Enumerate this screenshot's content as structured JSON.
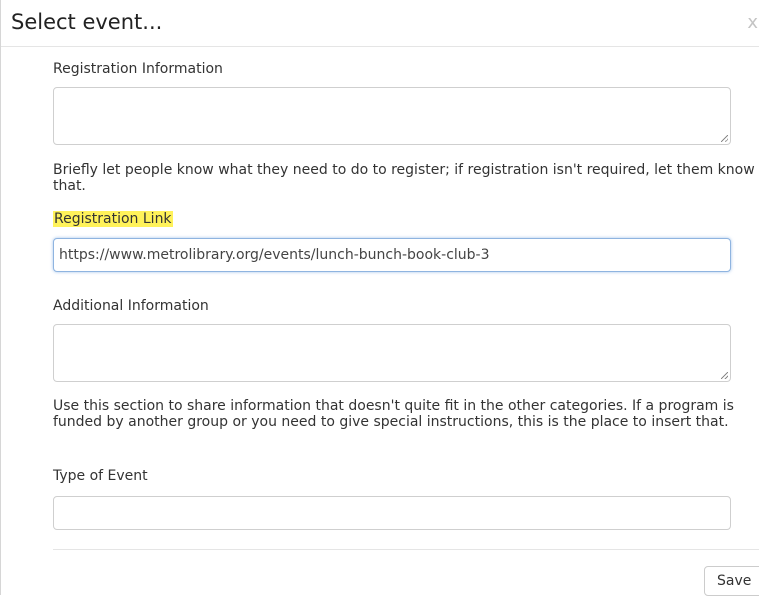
{
  "dialog": {
    "title": "Select event...",
    "close_label": "x"
  },
  "form": {
    "registration_information": {
      "label": "Registration Information",
      "value": "",
      "help": "Briefly let people know what they need to do to register; if registration isn't required, let them know that."
    },
    "registration_link": {
      "label": "Registration Link",
      "value": "https://www.metrolibrary.org/events/lunch-bunch-book-club-3",
      "highlight_color": "#fff25a"
    },
    "additional_information": {
      "label": "Additional Information",
      "value": "",
      "help": "Use this section to share information that doesn't quite fit in the other categories. If a program is funded by another group or you need to give special instructions, this is the place to insert that."
    },
    "type_of_event": {
      "label": "Type of Event",
      "value": ""
    }
  },
  "footer": {
    "save_label": "Save"
  }
}
